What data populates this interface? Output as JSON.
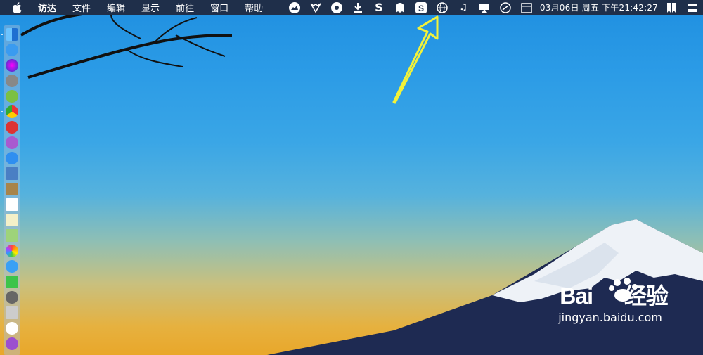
{
  "menubar": {
    "apple_icon": "apple-logo",
    "items": [
      "访达",
      "文件",
      "编辑",
      "显示",
      "前往",
      "窗口",
      "帮助"
    ]
  },
  "status_icons": [
    "photo-icon",
    "fox-icon",
    "eye-icon",
    "download-icon",
    "s-icon",
    "ghost-icon",
    "sogou-input-icon",
    "globe-icon",
    "music-note-icon",
    "display-icon",
    "clock-icon",
    "calendar-icon"
  ],
  "clock": {
    "text": "03月06日 周五 下午21:42:27"
  },
  "right_icons": [
    "bookmark-icon",
    "switch-icon"
  ],
  "dock": {
    "apps": [
      "finder",
      "app-store",
      "siri",
      "launchpad",
      "android-file-transfer",
      "chrome",
      "wps",
      "screen-recorder",
      "safari",
      "preview",
      "notes",
      "calendar",
      "stickies",
      "maps",
      "photos",
      "messages",
      "facetime",
      "system-preferences",
      "disk-utility",
      "itunes",
      "podcasts"
    ]
  },
  "watermark": {
    "brand": "Bai",
    "brand_suffix": "经验",
    "url": "jingyan.baidu.com"
  },
  "colors": {
    "menubar": "#1f2f4a",
    "arrow": "#f2f23a"
  }
}
